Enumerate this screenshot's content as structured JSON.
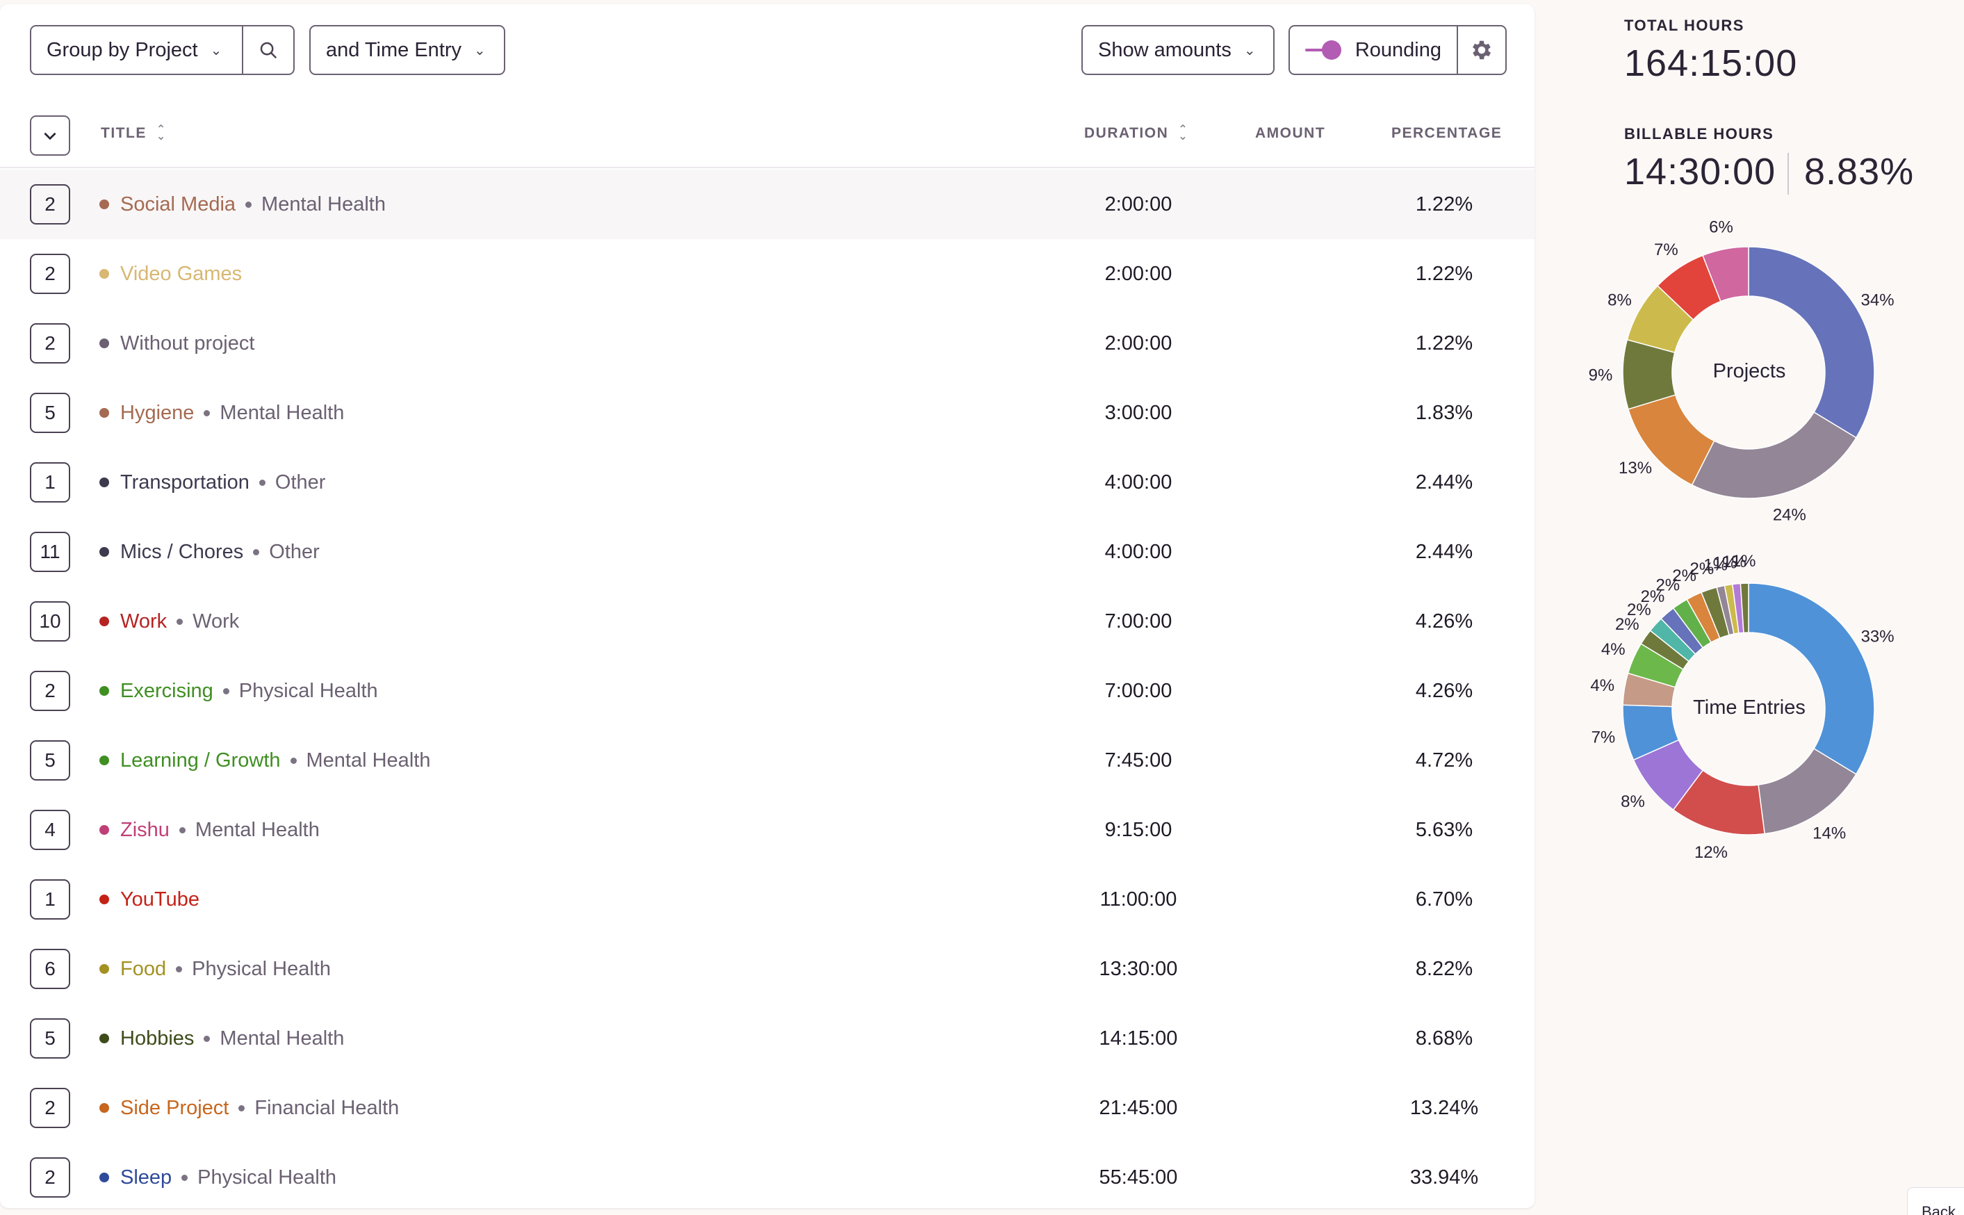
{
  "toolbar": {
    "group_by": "Group by Project",
    "and_entry": "and Time Entry",
    "show_amounts": "Show amounts",
    "rounding": "Rounding"
  },
  "table": {
    "headers": {
      "title": "TITLE",
      "duration": "DURATION",
      "amount": "AMOUNT",
      "percentage": "PERCENTAGE"
    },
    "rows": [
      {
        "count": "2",
        "project": "Social Media",
        "client": "Mental Health",
        "color": "#a56a52",
        "duration": "2:00:00",
        "percentage": "1.22%"
      },
      {
        "count": "2",
        "project": "Video Games",
        "client": "",
        "color": "#d8b772",
        "duration": "2:00:00",
        "percentage": "1.22%"
      },
      {
        "count": "2",
        "project": "Without project",
        "client": "",
        "color": "#6b6172",
        "duration": "2:00:00",
        "percentage": "1.22%"
      },
      {
        "count": "5",
        "project": "Hygiene",
        "client": "Mental Health",
        "color": "#a56a52",
        "duration": "3:00:00",
        "percentage": "1.83%"
      },
      {
        "count": "1",
        "project": "Transportation",
        "client": "Other",
        "color": "#3d3a4e",
        "duration": "4:00:00",
        "percentage": "2.44%"
      },
      {
        "count": "11",
        "project": "Mics / Chores",
        "client": "Other",
        "color": "#3d3a4e",
        "duration": "4:00:00",
        "percentage": "2.44%"
      },
      {
        "count": "10",
        "project": "Work",
        "client": "Work",
        "color": "#b52323",
        "duration": "7:00:00",
        "percentage": "4.26%"
      },
      {
        "count": "2",
        "project": "Exercising",
        "client": "Physical Health",
        "color": "#3f8f22",
        "duration": "7:00:00",
        "percentage": "4.26%"
      },
      {
        "count": "5",
        "project": "Learning / Growth",
        "client": "Mental Health",
        "color": "#3f8f22",
        "duration": "7:45:00",
        "percentage": "4.72%"
      },
      {
        "count": "4",
        "project": "Zishu",
        "client": "Mental Health",
        "color": "#c03f77",
        "duration": "9:15:00",
        "percentage": "5.63%"
      },
      {
        "count": "1",
        "project": "YouTube",
        "client": "",
        "color": "#c42216",
        "duration": "11:00:00",
        "percentage": "6.70%"
      },
      {
        "count": "6",
        "project": "Food",
        "client": "Physical Health",
        "color": "#a39123",
        "duration": "13:30:00",
        "percentage": "8.22%"
      },
      {
        "count": "5",
        "project": "Hobbies",
        "client": "Mental Health",
        "color": "#3d4c1b",
        "duration": "14:15:00",
        "percentage": "8.68%"
      },
      {
        "count": "2",
        "project": "Side Project",
        "client": "Financial Health",
        "color": "#c7661e",
        "duration": "21:45:00",
        "percentage": "13.24%"
      },
      {
        "count": "2",
        "project": "Sleep",
        "client": "Physical Health",
        "color": "#2f4a9a",
        "duration": "55:45:00",
        "percentage": "33.94%"
      }
    ]
  },
  "summary": {
    "total_label": "TOTAL HOURS",
    "total_value": "164:15:00",
    "billable_label": "BILLABLE HOURS",
    "billable_value": "14:30:00",
    "billable_pct": "8.83%"
  },
  "chart_data": [
    {
      "type": "pie",
      "title": "Projects",
      "slices": [
        {
          "value": 34,
          "label": "34%",
          "color": "#6673ba"
        },
        {
          "value": 24,
          "label": "24%",
          "color": "#938696"
        },
        {
          "value": 13,
          "label": "13%",
          "color": "#d9853d"
        },
        {
          "value": 9,
          "label": "9%",
          "color": "#6f793c"
        },
        {
          "value": 8,
          "label": "8%",
          "color": "#ccbb4c"
        },
        {
          "value": 7,
          "label": "7%",
          "color": "#e2443b"
        },
        {
          "value": 6,
          "label": "6%",
          "color": "#d0679f"
        }
      ]
    },
    {
      "type": "pie",
      "title": "Time Entries",
      "slices": [
        {
          "value": 33,
          "label": "33%",
          "color": "#4f92d8"
        },
        {
          "value": 14,
          "label": "14%",
          "color": "#938696"
        },
        {
          "value": 12,
          "label": "12%",
          "color": "#d24e4c"
        },
        {
          "value": 8,
          "label": "8%",
          "color": "#9c75d6"
        },
        {
          "value": 7,
          "label": "7%",
          "color": "#4f92d8"
        },
        {
          "value": 4,
          "label": "4%",
          "color": "#c59a86"
        },
        {
          "value": 4,
          "label": "4%",
          "color": "#6cb84a"
        },
        {
          "value": 2,
          "label": "2%",
          "color": "#6f793c"
        },
        {
          "value": 2,
          "label": "2%",
          "color": "#4fb6a8"
        },
        {
          "value": 2,
          "label": "2%",
          "color": "#6673ba"
        },
        {
          "value": 2,
          "label": "2%",
          "color": "#62b049"
        },
        {
          "value": 2,
          "label": "2%",
          "color": "#d9853d"
        },
        {
          "value": 2,
          "label": "2%",
          "color": "#6f793c"
        },
        {
          "value": 1,
          "label": "1%",
          "color": "#938696"
        },
        {
          "value": 1,
          "label": "1%",
          "color": "#ccbb4c"
        },
        {
          "value": 1,
          "label": "1%",
          "color": "#b37bd6"
        },
        {
          "value": 1,
          "label": "1%",
          "color": "#6f793c"
        }
      ]
    }
  ],
  "back_label": "Back"
}
